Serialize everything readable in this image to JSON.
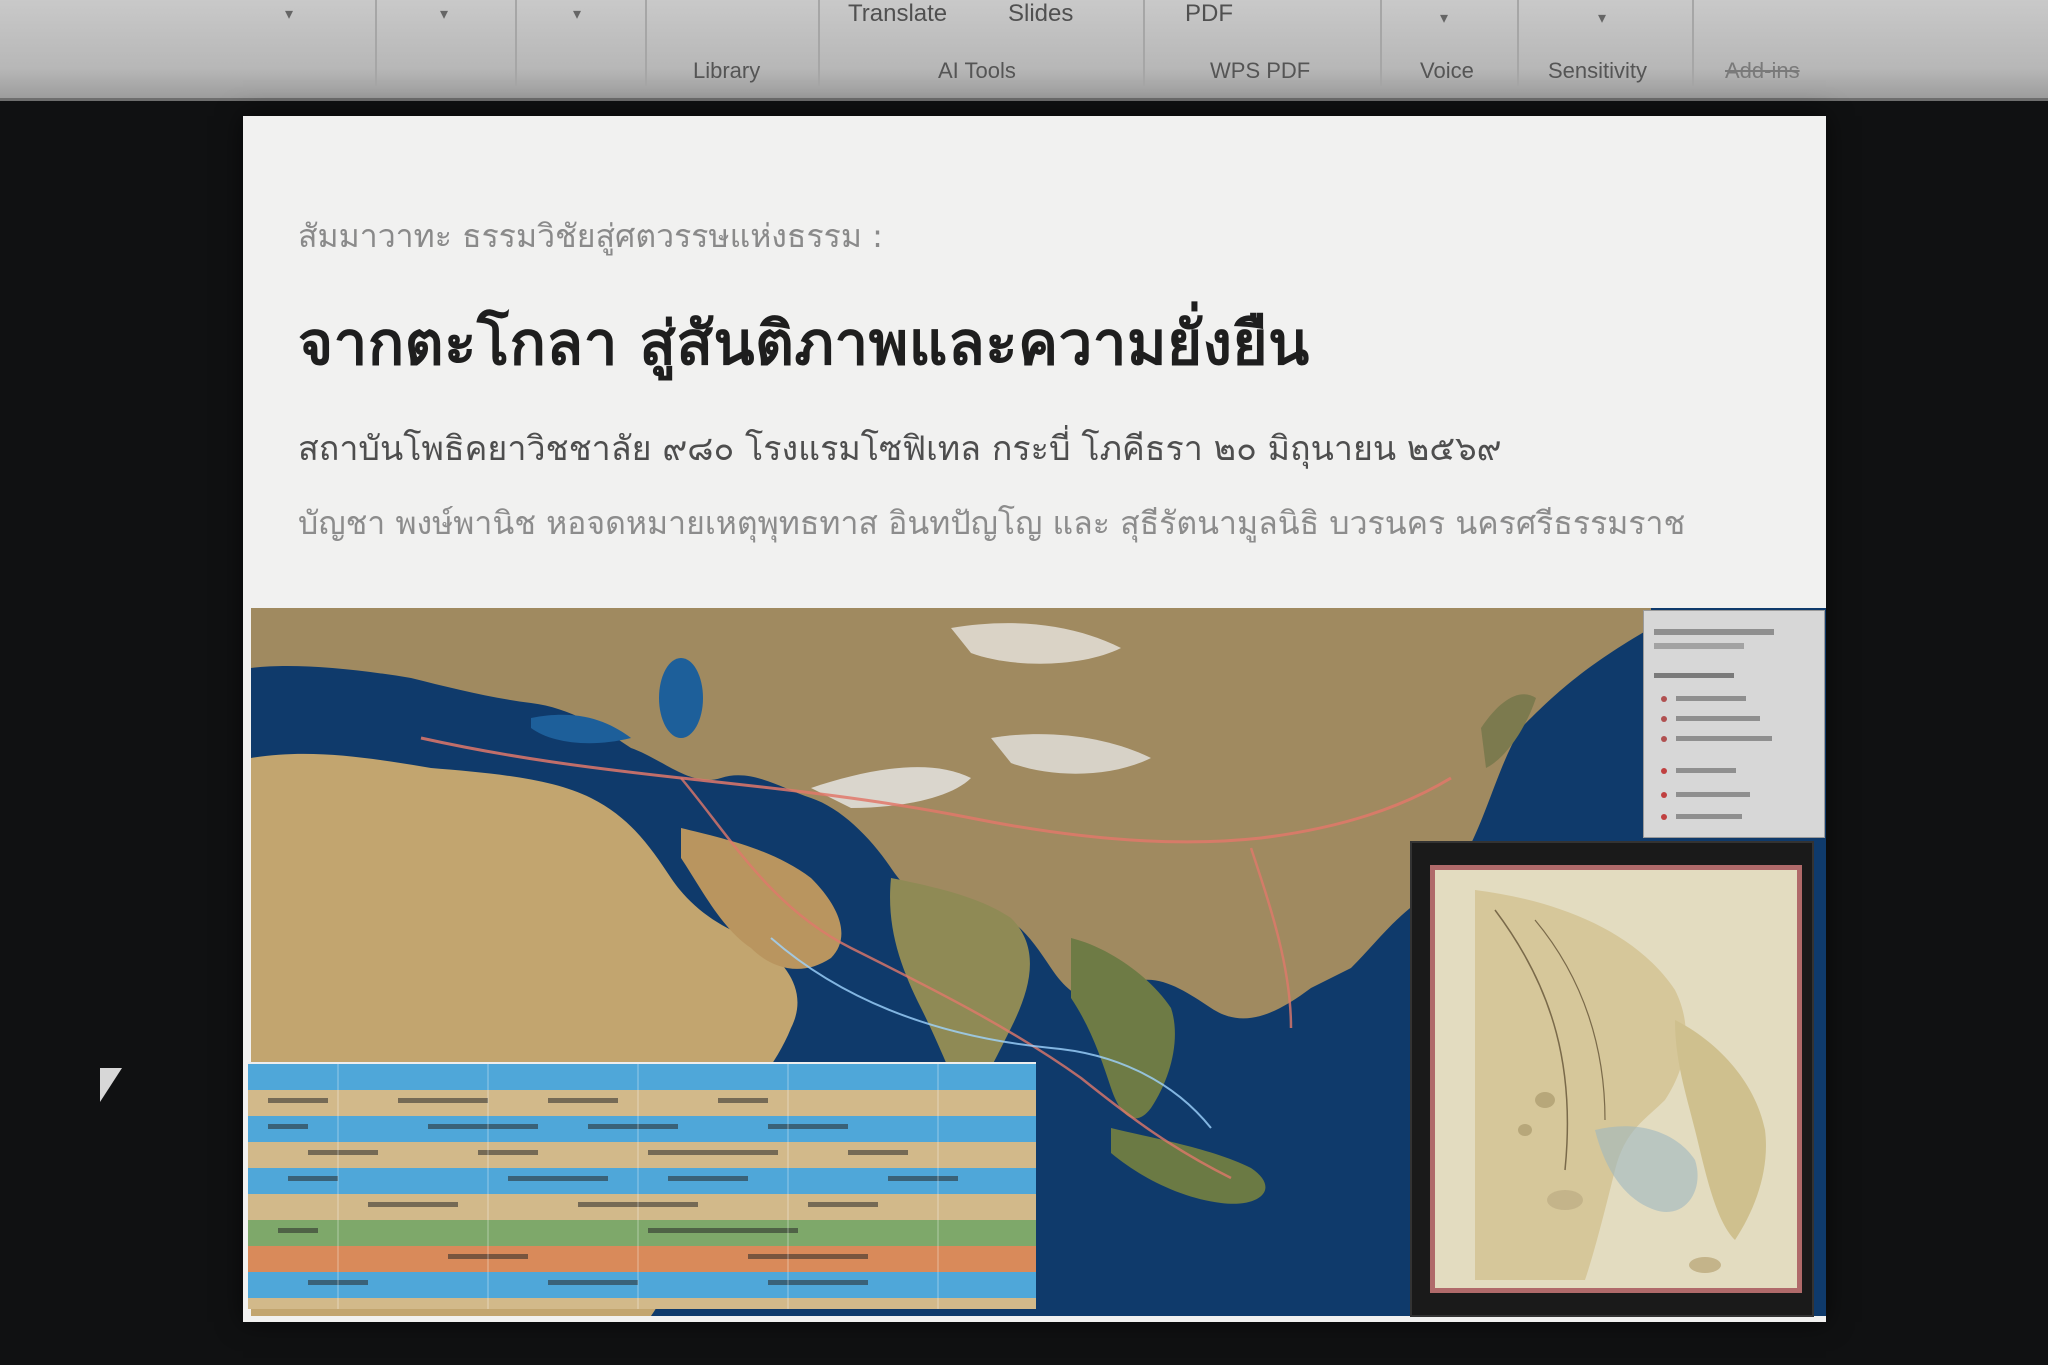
{
  "ribbon": {
    "tools": {
      "translate": "Translate",
      "slides": "Slides",
      "pdf": "PDF"
    },
    "groups": {
      "library": "Library",
      "ai_tools": "AI Tools",
      "wps_pdf": "WPS PDF",
      "voice": "Voice",
      "sensitivity": "Sensitivity",
      "add_ins": "Add-ins"
    }
  },
  "slide": {
    "kicker": "สัมมาวาทะ ธรรมวิชัยสู่ศตวรรษแห่งธรรม :",
    "title": "จากตะโกลา สู่สันติภาพและความยั่งยืน",
    "subtitle": "สถาบันโพธิคยาวิชชาลัย ๙๘๐ โรงแรมโซฟิเทล กระบี่ โภคีธรา ๒๐ มิถุนายน ๒๕๖๙",
    "authors": "บัญชา พงษ์พานิช หอจดหมายเหตุพุทธทาส อินทปัญโญ และ สุธีรัตนามูลนิธิ บวรนคร นครศรีธรรมราช"
  },
  "colors": {
    "ocean": "#0f3a6b",
    "land": "#b59a6a",
    "route": "#e0786a",
    "timeline_blue": "#4fa7d9",
    "timeline_sand": "#d2b98a",
    "map_frame": "#b06a6a"
  },
  "icons": {
    "pointer": "mouse-pointer-icon",
    "chevron": "chevron-down-icon"
  }
}
